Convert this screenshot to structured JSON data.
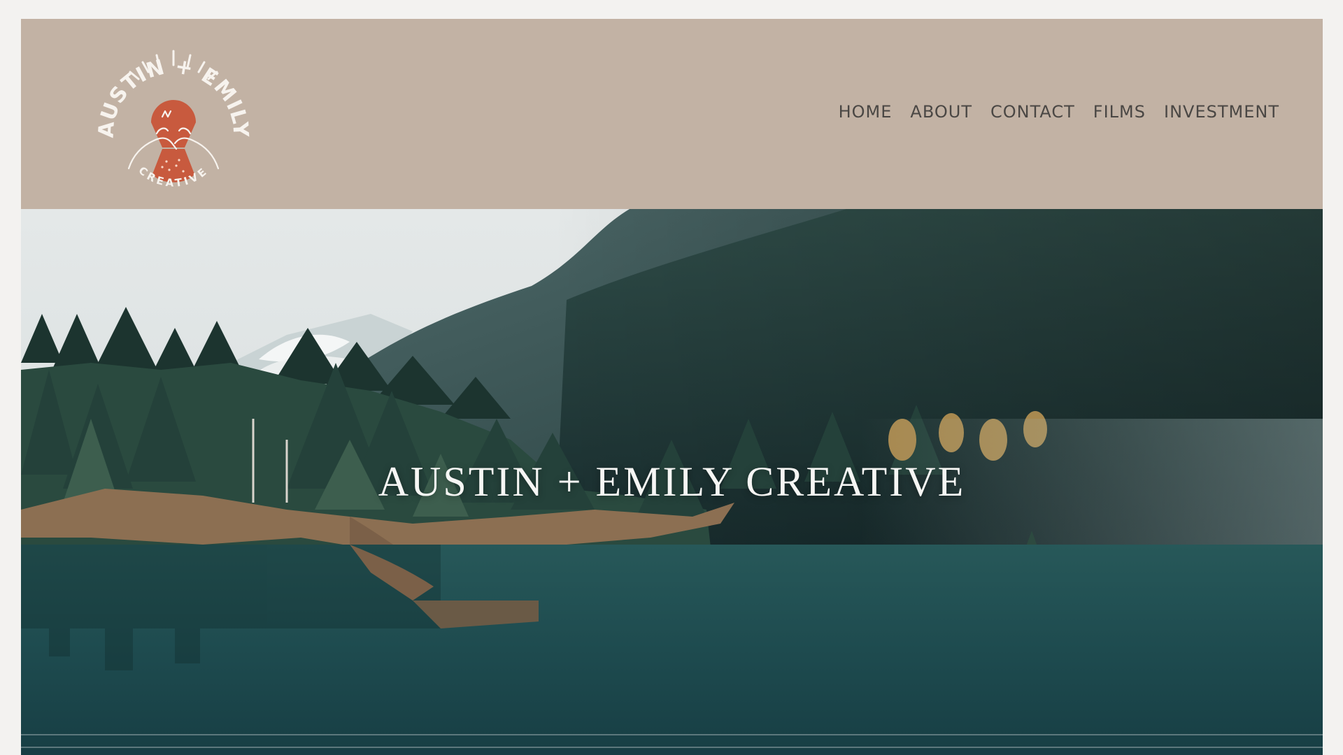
{
  "brand": {
    "logo_top_text": "AUSTIN + EMILY",
    "logo_bottom_text": "CREATIVE",
    "logo_accent_color": "#c85a3e",
    "header_background": "#c2b2a4"
  },
  "nav": {
    "items": [
      {
        "label": "HOME"
      },
      {
        "label": "ABOUT"
      },
      {
        "label": "CONTACT"
      },
      {
        "label": "FILMS"
      },
      {
        "label": "INVESTMENT"
      }
    ]
  },
  "hero": {
    "title": "AUSTIN + EMILY CREATIVE",
    "image_subject": "forest-lake-mountain-landscape"
  }
}
